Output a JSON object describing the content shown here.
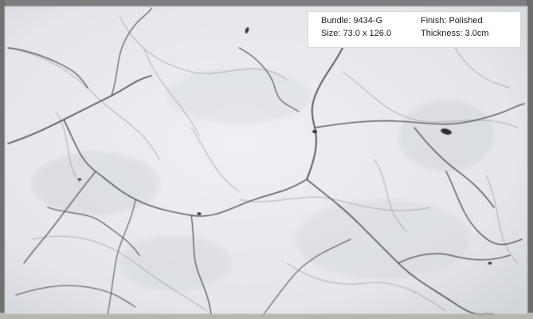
{
  "image": {
    "subject": "marble-slab",
    "colors": {
      "slab_base": "#e7e9ed",
      "vein_dark": "#4a4d52",
      "vein_light": "#9ea2a8",
      "background_frame": "#8d8f8d",
      "card_background": "#ffffff",
      "card_text": "#222222"
    }
  },
  "info_card": {
    "bundle": "Bundle: 9434-G",
    "size": "Size: 73.0 x 126.0",
    "finish": "Finish: Polished",
    "thickness": "Thickness: 3.0cm"
  }
}
